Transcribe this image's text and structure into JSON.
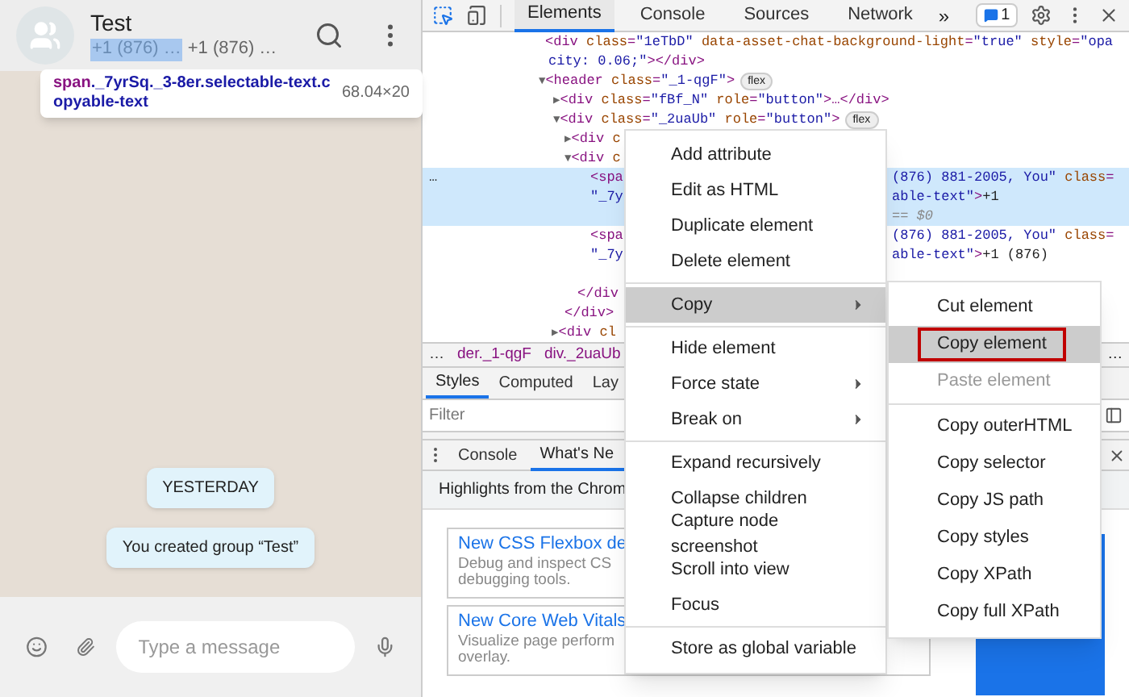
{
  "chat": {
    "title": "Test",
    "subtitle": [
      {
        "text": "+1 (876) …",
        "selected": true
      },
      {
        "text": "+1 (876) …",
        "selected": false
      }
    ],
    "tooltip": {
      "tag": "span",
      "classes": "._7yrSq._3-8er.selectable-text.copyable-text",
      "size": "68.04×20"
    },
    "messages": [
      "YESTERDAY",
      "You created group “Test”"
    ],
    "composer": {
      "placeholder": "Type a message"
    }
  },
  "devtools": {
    "tabs": [
      {
        "label": "Elements",
        "selected": true
      },
      {
        "label": "Console",
        "selected": false
      },
      {
        "label": "Sources",
        "selected": false
      },
      {
        "label": "Network",
        "selected": false
      }
    ],
    "more_tabs": "»",
    "issues_count": "1",
    "dom_lines": [
      {
        "selected": false,
        "left": [
          {
            "kind": "tag",
            "text": "<div "
          },
          {
            "kind": "attr",
            "text": "class"
          },
          {
            "kind": "tag",
            "text": "="
          },
          {
            "kind": "val",
            "text": "\"1eTbD\""
          },
          {
            "kind": "attr",
            "text": " data-asset-chat-background-light"
          },
          {
            "kind": "tag",
            "text": "="
          },
          {
            "kind": "val",
            "text": "\"true\""
          },
          {
            "kind": "attr",
            "text": " style"
          },
          {
            "kind": "tag",
            "text": "="
          },
          {
            "kind": "val",
            "text": "\"opa"
          }
        ]
      },
      {
        "selected": false,
        "left": [
          {
            "kind": "val",
            "text": "city: 0.06;\""
          },
          {
            "kind": "tag",
            "text": "></div>"
          }
        ]
      },
      {
        "selected": false,
        "left": [
          {
            "kind": "arrow",
            "text": "▼"
          },
          {
            "kind": "tag",
            "text": "<header "
          },
          {
            "kind": "attr",
            "text": "class"
          },
          {
            "kind": "tag",
            "text": "="
          },
          {
            "kind": "val",
            "text": "\"_1-qgF\""
          },
          {
            "kind": "tag",
            "text": ">"
          }
        ],
        "badge": "flex"
      },
      {
        "selected": false,
        "left": [
          {
            "kind": "arrow",
            "text": "▶"
          },
          {
            "kind": "tag",
            "text": "<div "
          },
          {
            "kind": "attr",
            "text": "class"
          },
          {
            "kind": "tag",
            "text": "="
          },
          {
            "kind": "val",
            "text": "\"fBf_N\""
          },
          {
            "kind": "attr",
            "text": " role"
          },
          {
            "kind": "tag",
            "text": "="
          },
          {
            "kind": "val",
            "text": "\"button\""
          },
          {
            "kind": "tag",
            "text": ">…</div>"
          }
        ]
      },
      {
        "selected": false,
        "left": [
          {
            "kind": "arrow",
            "text": "▼"
          },
          {
            "kind": "tag",
            "text": "<div "
          },
          {
            "kind": "attr",
            "text": "class"
          },
          {
            "kind": "tag",
            "text": "="
          },
          {
            "kind": "val",
            "text": "\"_2uaUb\""
          },
          {
            "kind": "attr",
            "text": " role"
          },
          {
            "kind": "tag",
            "text": "="
          },
          {
            "kind": "val",
            "text": "\"button\""
          },
          {
            "kind": "tag",
            "text": ">"
          }
        ],
        "badge": "flex"
      },
      {
        "selected": false,
        "left": [
          {
            "kind": "arrow",
            "text": "▶"
          },
          {
            "kind": "tag",
            "text": "<div "
          },
          {
            "kind": "attr",
            "text": "c"
          }
        ]
      },
      {
        "selected": false,
        "left": [
          {
            "kind": "arrow",
            "text": "▼"
          },
          {
            "kind": "tag",
            "text": "<div "
          },
          {
            "kind": "attr",
            "text": "c"
          }
        ]
      },
      {
        "selected": true,
        "gutter": "…",
        "left": [
          {
            "kind": "tag",
            "text": "<spa"
          }
        ],
        "right": [
          {
            "kind": "val",
            "text": "(876) 881-2005, You\""
          },
          {
            "kind": "attr",
            "text": " class"
          },
          {
            "kind": "tag",
            "text": "="
          }
        ]
      },
      {
        "selected": true,
        "left": [
          {
            "kind": "val",
            "text": "\"_7y"
          }
        ],
        "right": [
          {
            "kind": "val",
            "text": "able-text\""
          },
          {
            "kind": "tag",
            "text": ">"
          },
          {
            "kind": "plain",
            "text": "+1"
          }
        ]
      },
      {
        "selected": true,
        "right": [
          {
            "kind": "dim",
            "text": "== $0"
          }
        ]
      },
      {
        "selected": false,
        "left": [
          {
            "kind": "tag",
            "text": "<spa"
          }
        ],
        "right": [
          {
            "kind": "val",
            "text": "(876) 881-2005, You\""
          },
          {
            "kind": "attr",
            "text": " class"
          },
          {
            "kind": "tag",
            "text": "="
          }
        ]
      },
      {
        "selected": false,
        "left": [
          {
            "kind": "val",
            "text": "\"_7y"
          }
        ],
        "right": [
          {
            "kind": "val",
            "text": "able-text\""
          },
          {
            "kind": "tag",
            "text": ">"
          },
          {
            "kind": "plain",
            "text": "+1 (876)"
          }
        ]
      },
      {
        "selected": false
      },
      {
        "selected": false,
        "left": [
          {
            "kind": "tag",
            "text": "</div"
          }
        ]
      },
      {
        "selected": false,
        "left": [
          {
            "kind": "tag",
            "text": "</div>"
          }
        ]
      },
      {
        "selected": false,
        "left": [
          {
            "kind": "arrow",
            "text": "▶"
          },
          {
            "kind": "tag",
            "text": "<div "
          },
          {
            "kind": "attr",
            "text": "cl"
          }
        ]
      }
    ],
    "breadcrumbs": [
      {
        "text": "…",
        "kind": "ellipsis"
      },
      {
        "text": "der._1-qgF",
        "kind": "node"
      },
      {
        "text": "div._2uaUb",
        "kind": "node"
      }
    ],
    "breadcrumb_more": "…",
    "style_tabs": [
      {
        "label": "Styles",
        "selected": true
      },
      {
        "label": "Computed",
        "selected": false
      },
      {
        "label": "Lay",
        "selected": false
      }
    ],
    "filter": {
      "placeholder": "Filter"
    },
    "drawer_tabs": [
      {
        "label": "Console",
        "selected": false
      },
      {
        "label": "What's Ne",
        "selected": true
      }
    ],
    "whats_new_title": "Highlights from the Chrom",
    "cards": [
      {
        "title": "New CSS Flexbox de",
        "text": "Debug and inspect CS\ndebugging tools."
      },
      {
        "title": "New Core Web Vitals",
        "text": "Visualize page perform\noverlay."
      }
    ]
  },
  "context_menu": {
    "groups": [
      [
        {
          "label": "Add attribute",
          "submenu": false,
          "selected": false
        },
        {
          "label": "Edit as HTML",
          "submenu": false,
          "selected": false
        },
        {
          "label": "Duplicate element",
          "submenu": false,
          "selected": false
        },
        {
          "label": "Delete element",
          "submenu": false,
          "selected": false
        }
      ],
      [
        {
          "label": "Copy",
          "submenu": true,
          "selected": true
        }
      ],
      [
        {
          "label": "Hide element",
          "submenu": false,
          "selected": false
        },
        {
          "label": "Force state",
          "submenu": true,
          "selected": false
        },
        {
          "label": "Break on",
          "submenu": true,
          "selected": false
        }
      ],
      [
        {
          "label": "Expand recursively",
          "submenu": false,
          "selected": false
        },
        {
          "label": "Collapse children",
          "submenu": false,
          "selected": false
        },
        {
          "label": "Capture node screenshot",
          "submenu": false,
          "selected": false
        },
        {
          "label": "Scroll into view",
          "submenu": false,
          "selected": false
        },
        {
          "label": "Focus",
          "submenu": false,
          "selected": false
        }
      ],
      [
        {
          "label": "Store as global variable",
          "submenu": false,
          "selected": false
        }
      ]
    ]
  },
  "submenu": {
    "groups": [
      [
        {
          "label": "Cut element",
          "selected": false,
          "disabled": false
        },
        {
          "label": "Copy element",
          "selected": true,
          "disabled": false
        },
        {
          "label": "Paste element",
          "selected": false,
          "disabled": true
        }
      ],
      [
        {
          "label": "Copy outerHTML",
          "selected": false,
          "disabled": false
        },
        {
          "label": "Copy selector",
          "selected": false,
          "disabled": false
        },
        {
          "label": "Copy JS path",
          "selected": false,
          "disabled": false
        },
        {
          "label": "Copy styles",
          "selected": false,
          "disabled": false
        },
        {
          "label": "Copy XPath",
          "selected": false,
          "disabled": false
        },
        {
          "label": "Copy full XPath",
          "selected": false,
          "disabled": false
        }
      ]
    ]
  }
}
